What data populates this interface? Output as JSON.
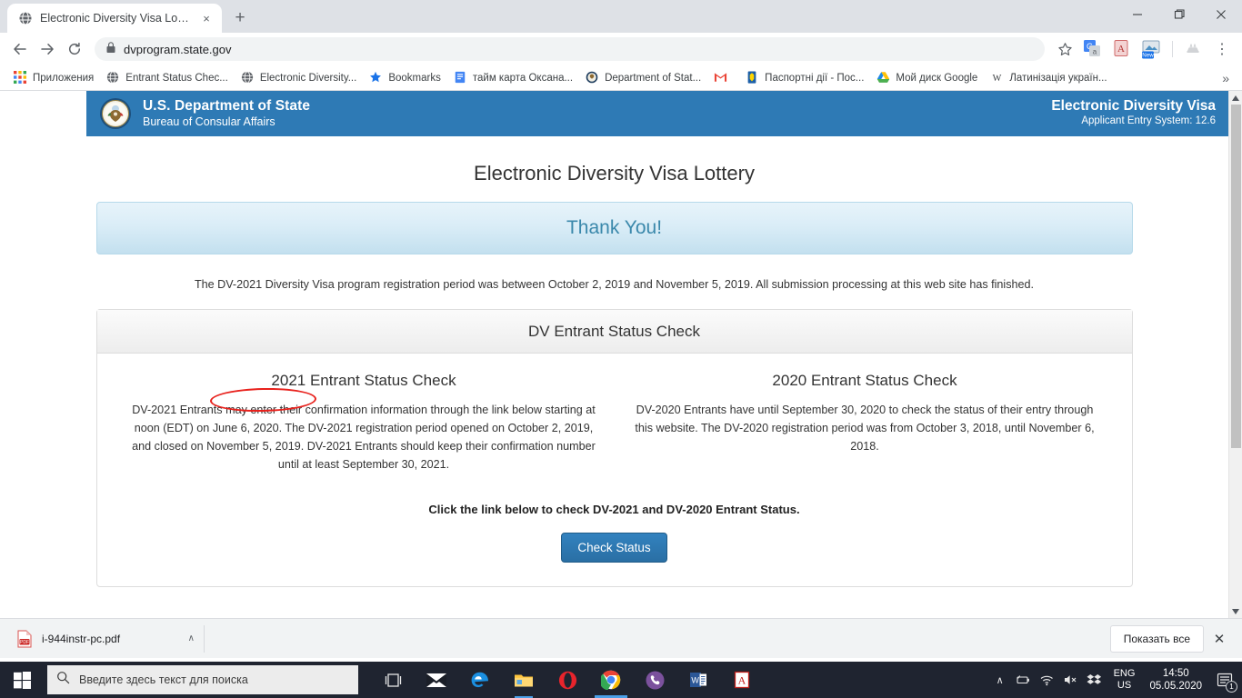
{
  "browser": {
    "tab": {
      "title": "Electronic Diversity Visa Lottery",
      "favicon": "globe-icon",
      "close": "×"
    },
    "new_tab_label": "+",
    "window_controls": {
      "minimize": "–",
      "maximize": "❐",
      "close": "✕"
    },
    "nav": {
      "back": "←",
      "forward": "→",
      "reload": "↻"
    },
    "omnibox": {
      "url": "dvprogram.state.gov",
      "lock": "lock-icon",
      "star": "☆"
    },
    "extensions": [
      {
        "name": "google-translate-extension",
        "label": "G"
      },
      {
        "name": "adobe-acrobat-extension",
        "label": "A"
      },
      {
        "name": "screenshot-extension",
        "label": "New"
      },
      {
        "name": "disabled-extension",
        "label": ""
      }
    ],
    "menu": "⋮",
    "bookmarks": [
      {
        "label": "Приложения",
        "icon": "apps-grid-icon"
      },
      {
        "label": "Entrant Status Chec...",
        "icon": "globe-icon"
      },
      {
        "label": "Electronic Diversity...",
        "icon": "globe-icon"
      },
      {
        "label": "Bookmarks",
        "icon": "star-icon"
      },
      {
        "label": "тайм карта Оксана...",
        "icon": "doc-blue-icon"
      },
      {
        "label": "Department of Stat...",
        "icon": "seal-icon"
      },
      {
        "label": "",
        "icon": "gmail-icon"
      },
      {
        "label": "Паспортні дії - Пос...",
        "icon": "ua-emblem-icon"
      },
      {
        "label": "Мой диск Google",
        "icon": "google-drive-icon"
      },
      {
        "label": "Латинізація україн...",
        "icon": "wikipedia-icon"
      }
    ],
    "bookmarks_overflow": "»"
  },
  "site": {
    "banner": {
      "seal": "us-department-of-state-seal",
      "agency": "U.S. Department of State",
      "bureau": "Bureau of Consular Affairs",
      "system_title": "Electronic Diversity Visa",
      "system_version": "Applicant Entry System: 12.6",
      "color": "#2e7ab5"
    },
    "page_title": "Electronic Diversity Visa Lottery",
    "thank_you": "Thank You!",
    "intro": "The DV-2021 Diversity Visa program registration period was between October 2, 2019 and November 5, 2019. All submission processing at this web site has finished.",
    "panel": {
      "heading": "DV Entrant Status Check",
      "columns": [
        {
          "heading": "2021 Entrant Status Check",
          "text": "DV-2021 Entrants may enter their confirmation information through the link below starting at noon (EDT) on June 6, 2020. The DV-2021 registration period opened on October 2, 2019, and closed on November 5, 2019. DV-2021 Entrants should keep their confirmation number until at least September 30, 2021."
        },
        {
          "heading": "2020 Entrant Status Check",
          "text": "DV-2020 Entrants have until September 30, 2020 to check the status of their entry through this website. The DV-2020 registration period was from October 3, 2018, until November 6, 2018."
        }
      ],
      "click_note": "Click the link below to check DV-2021 and DV-2020 Entrant Status.",
      "button_label": "Check Status"
    },
    "annotation": {
      "type": "red-ellipse",
      "encircled_text": "on June 6, 2020.",
      "color": "#e8211c"
    }
  },
  "download_shelf": {
    "file_name": "i-944instr-pc.pdf",
    "file_icon": "pdf-icon",
    "caret": "∧",
    "show_all_label": "Показать все",
    "close": "✕"
  },
  "taskbar": {
    "start": "windows-logo",
    "search_placeholder": "Введите здесь текст для поиска",
    "apps": [
      {
        "name": "task-view-icon"
      },
      {
        "name": "mail-icon"
      },
      {
        "name": "edge-icon"
      },
      {
        "name": "file-explorer-icon"
      },
      {
        "name": "opera-icon"
      },
      {
        "name": "chrome-icon"
      },
      {
        "name": "viber-icon"
      },
      {
        "name": "word-icon"
      },
      {
        "name": "acrobat-icon"
      }
    ],
    "tray": {
      "chevron": "∧",
      "battery": "battery-icon",
      "wifi": "wifi-icon",
      "volume": "volume-muted-icon",
      "dropbox": "dropbox-icon",
      "language_line1": "ENG",
      "language_line2": "US",
      "time": "14:50",
      "date": "05.05.2020",
      "notification_count": "1"
    }
  }
}
